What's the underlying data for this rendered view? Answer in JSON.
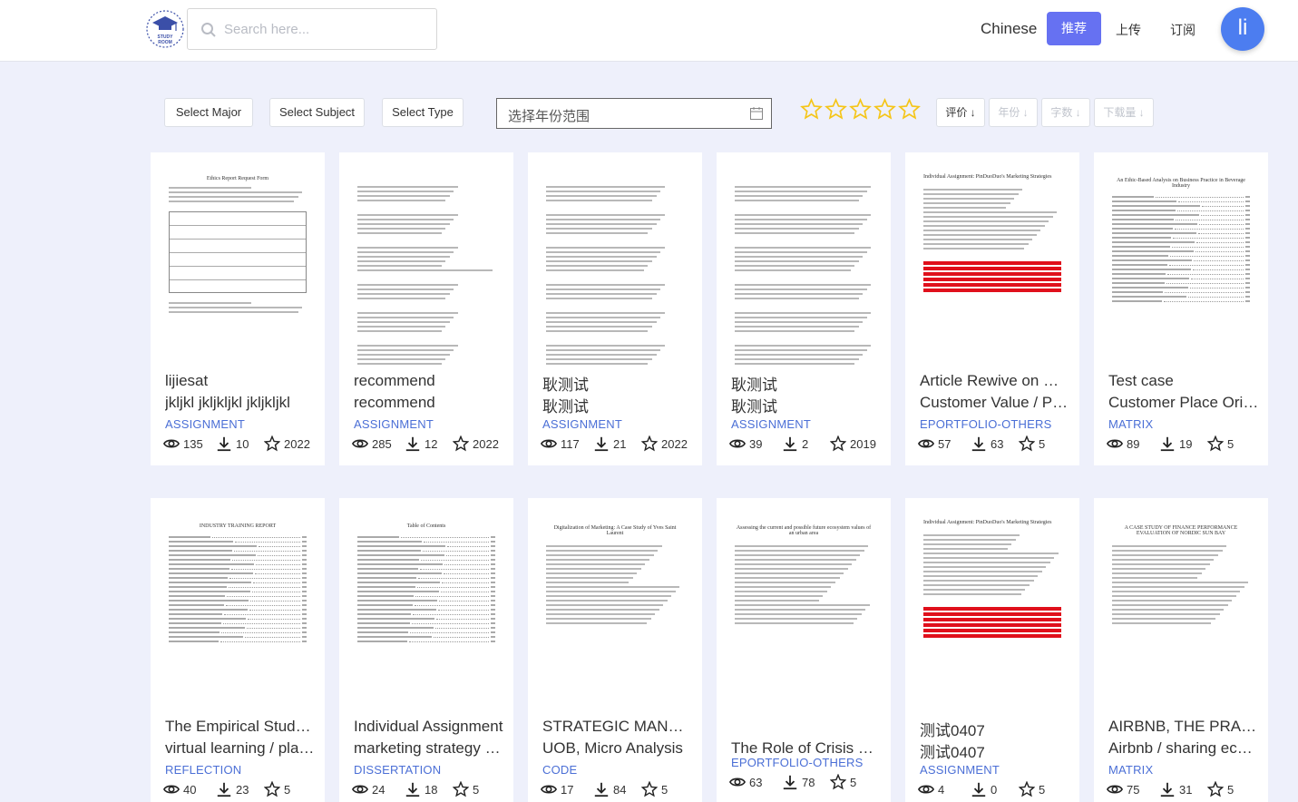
{
  "header": {
    "search_placeholder": "Search here...",
    "lang_label": "Chinese",
    "recommend_label": "推荐",
    "upload_label": "上传",
    "subscribe_label": "订阅",
    "avatar_letter": "li",
    "logo_text": "STUDY ROOM",
    "accent_color": "#6671f2"
  },
  "filters": {
    "major_label": "Select Major",
    "subject_label": "Select Subject",
    "type_label": "Select Type",
    "date_placeholder": "选择年份范围",
    "star_rating": 0,
    "sort": {
      "rating_label": "评价",
      "year_label": "年份",
      "words_label": "字数",
      "downloads_label": "下载量"
    }
  },
  "cards": [
    {
      "title1": "lijiesat",
      "title2": "jkljkl jkljkljkl jkljkljkl",
      "category": "ASSIGNMENT",
      "views": "135",
      "downloads": "10",
      "star": "2022"
    },
    {
      "title1": "recommend",
      "title2": "recommend",
      "category": "ASSIGNMENT",
      "views": "285",
      "downloads": "12",
      "star": "2022"
    },
    {
      "title1": "耿测试",
      "title2": "耿测试",
      "category": "ASSIGNMENT",
      "views": "117",
      "downloads": "21",
      "star": "2022"
    },
    {
      "title1": "耿测试",
      "title2": "耿测试",
      "category": "ASSIGNMENT",
      "views": "39",
      "downloads": "2",
      "star": "2019"
    },
    {
      "title1": "Article Rewive on Marketing",
      "title2": "Customer Value / Pinduoduo",
      "category": "EPORTFOLIO-OTHERS",
      "views": "57",
      "downloads": "63",
      "star": "5"
    },
    {
      "title1": "Test case",
      "title2": "Customer Place Orientation",
      "category": "MATRIX",
      "views": "89",
      "downloads": "19",
      "star": "5"
    },
    {
      "title1": "The Empirical Study of",
      "title2": "virtual learning / platform",
      "category": "REFLECTION",
      "views": "40",
      "downloads": "23",
      "star": "5"
    },
    {
      "title1": "Individual Assignment",
      "title2": "marketing strategy / PinDuoDuo",
      "category": "DISSERTATION",
      "views": "24",
      "downloads": "18",
      "star": "5"
    },
    {
      "title1": "STRATEGIC MANAGEMENT",
      "title2": "UOB, Micro Analysis",
      "category": "CODE",
      "views": "17",
      "downloads": "84",
      "star": "5"
    },
    {
      "title1": "The Role of Crisis Management",
      "title2": "",
      "category": "EPORTFOLIO-OTHERS",
      "views": "63",
      "downloads": "78",
      "star": "5"
    },
    {
      "title1": "测试0407",
      "title2": "测试0407",
      "category": "ASSIGNMENT",
      "views": "4",
      "downloads": "0",
      "star": "5"
    },
    {
      "title1": "AIRBNB, THE PRACTICE",
      "title2": "Airbnb / sharing economy",
      "category": "MATRIX",
      "views": "75",
      "downloads": "31",
      "star": "5"
    }
  ],
  "previews": [
    {
      "heading": "Ethics Report Request Form"
    },
    {
      "heading": ""
    },
    {
      "heading": ""
    },
    {
      "heading": ""
    },
    {
      "heading": "Individual Assignment: PinDuoDuo's Marketing Strategies"
    },
    {
      "heading": "An Ethic-Based Analysis on Business Practice in Beverage Industry"
    },
    {
      "heading": "INDUSTRY TRAINING REPORT"
    },
    {
      "heading": "Table of Contents"
    },
    {
      "heading": "Digitalization of Marketing: A Case Study of Yves Saint Laurent"
    },
    {
      "heading": "Assessing the current and possible future ecosystem values of an urban area"
    },
    {
      "heading": "Individual Assignment: PinDuoDuo's Marketing Strategies"
    },
    {
      "heading": "A CASE STUDY OF FINANCE PERFORMANCE EVALUATION OF NORDIC SUN BAY"
    }
  ]
}
